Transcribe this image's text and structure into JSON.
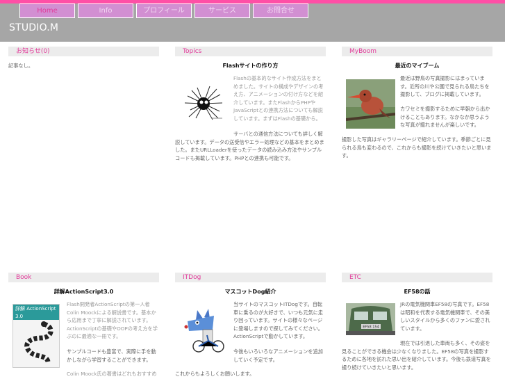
{
  "header": {
    "brand": "STUDIO.M",
    "nav": [
      "Home",
      "Info",
      "プロフィール",
      "サービス",
      "お問合せ"
    ]
  },
  "panels": {
    "news": {
      "title": "お知らせ(0)",
      "body": "記事なし。"
    },
    "topics": {
      "title": "Topics",
      "headline": "Flashサイトの作り方",
      "p1": "Flashの基本的なサイト作成方法をまとめました。サイトの構成やデザインの考え方、アニメーションの付け方などを紹介しています。またFlashからPHPやJavaScriptとの連携方法についても解説しています。まずはFlashの基礎から。",
      "p2": "サーバとの通信方法についても詳しく解説しています。データの送受信やエラー処理などの基本をまとめました。またURLLoaderを使ったデータの読み込み方法やサンプルコードも掲載しています。PHPとの連携も可能です。"
    },
    "myboom": {
      "title": "MyBoom",
      "headline": "最近のマイブーム",
      "p1": "最近は野鳥の写真撮影にはまっています。近所の川や公園で見られる鳥たちを撮影して、ブログに掲載しています。",
      "p2": "カワセミを撮影するために早朝から出かけることもあります。なかなか思うような写真が撮れませんが楽しいです。",
      "p3": "撮影した写真はギャラリーページで紹介しています。季節ごとに見られる鳥も変わるので、これからも撮影を続けていきたいと思います。"
    },
    "book": {
      "title": "Book",
      "headline": "詳解ActionScript3.0",
      "cover": "詳解 ActionScript 3.0",
      "p1": "Flash開発者ActionScriptの第一人者Colin Moockによる解説書です。基本から応用まで丁寧に解説されています。ActionScriptの基礎やOOPの考え方を学ぶのに最適な一冊です。",
      "p2": "サンプルコードも豊富で、実際に手を動かしながら学習することができます。",
      "p3": "Colin Moock氏の著書はどれもおすすめです。"
    },
    "itdog": {
      "title": "ITDog",
      "headline": "マスコットDog紹介",
      "p1": "当サイトのマスコットITDogです。自転車に乗るのが大好きで、いつも元気に走り回っています。サイトの様々なページに登場しますので探してみてください。ActionScriptで動かしています。",
      "p2": "今後もいろいろなアニメーションを追加していく予定です。",
      "p3": "これからもよろしくお願いします。"
    },
    "etc": {
      "title": "ETC",
      "headline": "EF58の話",
      "plate": "EF58 154",
      "p1": "JRの電気機関車EF58の写真です。EF58は昭和を代表する電気機関車で、その美しいスタイルから多くのファンに愛されています。",
      "p2": "現在では引退した車両も多く、その姿を見ることができる機会は少なくなりました。EF58の写真を撮影するために各地を訪れた思い出を紹介しています。今後も鉄道写真を撮り続けていきたいと思います。"
    }
  }
}
